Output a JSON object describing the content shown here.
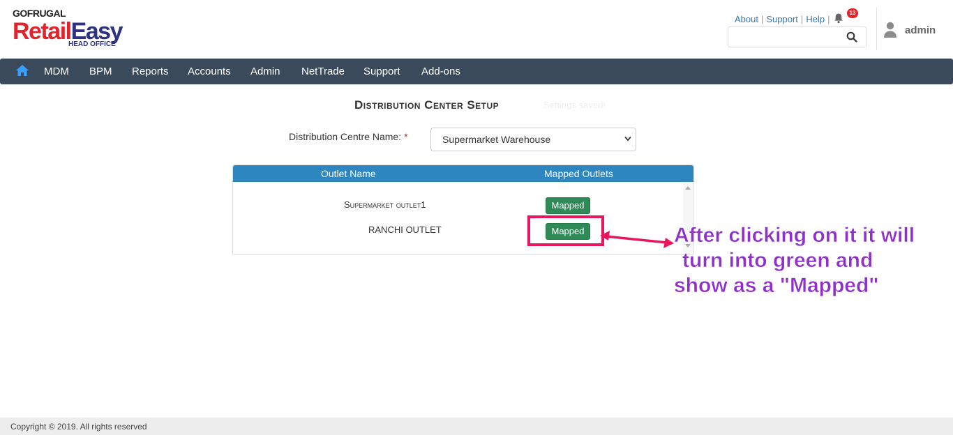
{
  "header": {
    "logo": {
      "brand_top": "GOFRUGAL",
      "brand_main_1": "Retail",
      "brand_main_2": "Easy",
      "brand_sub": "HEAD OFFICE"
    },
    "links": [
      "About",
      "Support",
      "Help"
    ],
    "notification_count": "13",
    "search": {
      "placeholder": "",
      "icon": "search-icon"
    },
    "user": {
      "name": "admin",
      "icon": "user-icon"
    }
  },
  "nav": {
    "home_icon": "home-icon",
    "items": [
      "MDM",
      "BPM",
      "Reports",
      "Accounts",
      "Admin",
      "NetTrade",
      "Support",
      "Add-ons"
    ]
  },
  "page": {
    "title": "Distribution Center Setup",
    "status_message": "Settings saved!",
    "dc_label": "Distribution Centre Name:",
    "required_mark": "*",
    "dc_selected": "Supermarket Warehouse"
  },
  "table": {
    "headers": [
      "Outlet Name",
      "Mapped Outlets"
    ],
    "rows": [
      {
        "outlet": "Supermarket outlet1",
        "status": "Mapped"
      },
      {
        "outlet": "RANCHI OUTLET",
        "status": "Mapped"
      }
    ]
  },
  "annotation": {
    "lines": [
      "After clicking on it it will",
      "turn into green and",
      "show as a \"Mapped\""
    ],
    "color": "#8e30c9",
    "highlight_color": "#e8175d"
  },
  "footer": {
    "copyright": "Copyright © 2019. All rights reserved"
  }
}
